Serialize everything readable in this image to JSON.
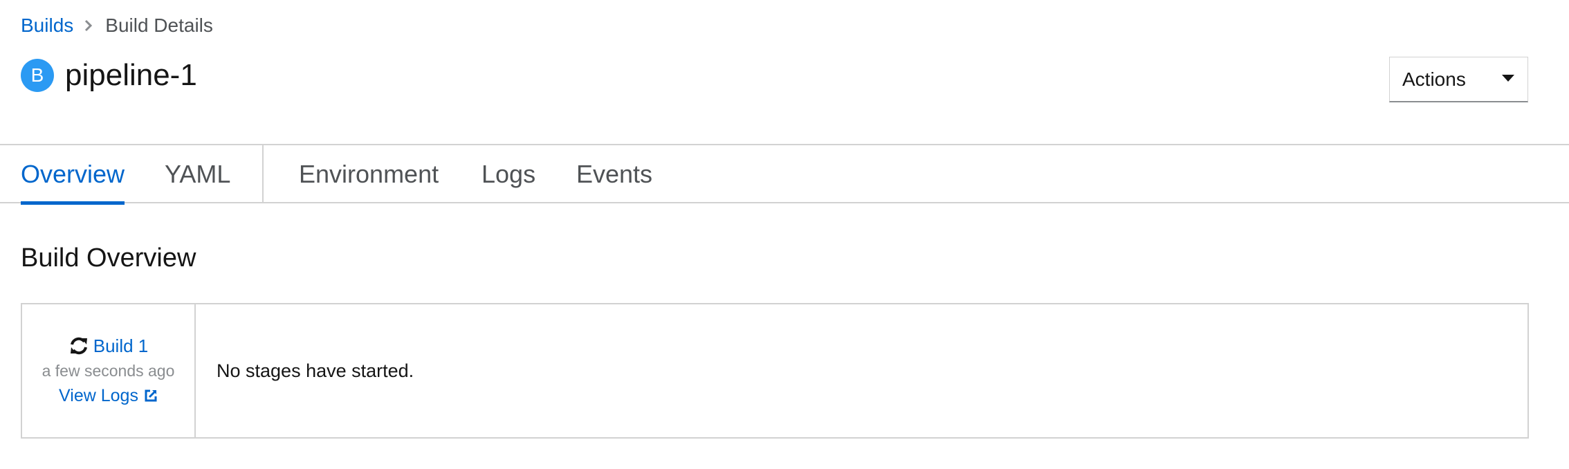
{
  "breadcrumb": {
    "parent": "Builds",
    "current": "Build Details"
  },
  "header": {
    "badge": "B",
    "title": "pipeline-1",
    "actions_label": "Actions"
  },
  "tabs": [
    {
      "label": "Overview",
      "active": true
    },
    {
      "label": "YAML",
      "active": false
    },
    {
      "label": "Environment",
      "active": false
    },
    {
      "label": "Logs",
      "active": false
    },
    {
      "label": "Events",
      "active": false
    }
  ],
  "overview": {
    "section_title": "Build Overview",
    "build": {
      "name": "Build 1",
      "timestamp": "a few seconds ago",
      "view_logs": "View Logs"
    },
    "stages_message": "No stages have started."
  },
  "colors": {
    "link": "#0066cc",
    "badge": "#2b9af3",
    "border": "#d2d2d2",
    "muted": "#8a8d90"
  },
  "icons": {
    "breadcrumb_separator": "chevron-right-icon",
    "actions_caret": "caret-down-icon",
    "build_status": "sync-icon",
    "external_link": "external-link-icon"
  }
}
